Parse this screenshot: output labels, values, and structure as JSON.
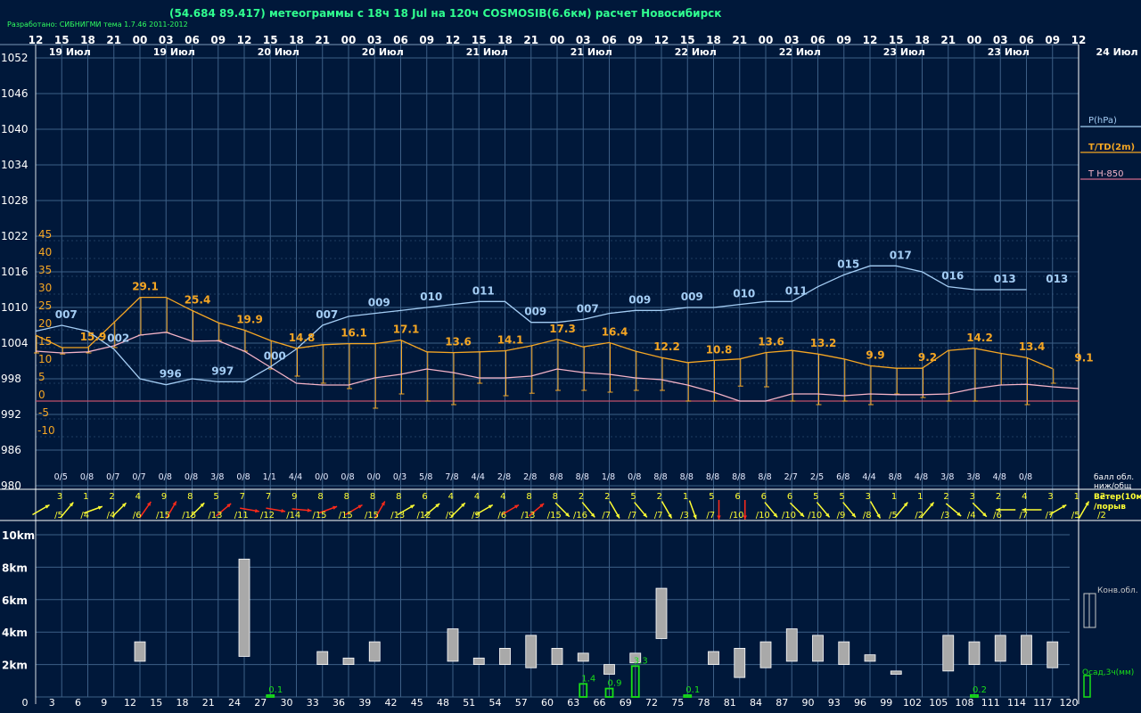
{
  "header": {
    "title": "(54.684 89.417) метеограммы с  18ч 18 Jul на 120ч COSMOSIB(6.6км) расчет Новосибирск",
    "credit": "Разработано: СИБНИГМИ тема 1.7.46 2011-2012"
  },
  "colors": {
    "background": "#00183a",
    "grid": "#3d5f86",
    "pressure": "#a4cdf4",
    "temperature": "#f5a623",
    "temp850": "#f5b4c8",
    "zero_line": "#c0506a",
    "cloud_bar": "#a9a9a9",
    "precip_bar": "#18e018",
    "wind_yellow": "#ffff33",
    "wind_red": "#ff2a1a",
    "text_white": "#ffffff",
    "credit": "#30ff60"
  },
  "chart_data": {
    "type": "line",
    "x_step_hours": 3,
    "top_hour_labels": [
      "12",
      "15",
      "18",
      "21",
      "00",
      "03",
      "06",
      "09",
      "12",
      "15",
      "18",
      "21",
      "00",
      "03",
      "06",
      "09",
      "12",
      "15",
      "18",
      "21",
      "00",
      "03",
      "06",
      "09",
      "12",
      "15",
      "18",
      "21",
      "00",
      "03",
      "06",
      "09",
      "12",
      "15",
      "18",
      "21",
      "00",
      "03",
      "06",
      "09",
      "12"
    ],
    "date_labels": [
      {
        "i": 1,
        "text": "19 Июл"
      },
      {
        "i": 5,
        "text": "19 Июл"
      },
      {
        "i": 9,
        "text": "20 Июл"
      },
      {
        "i": 13,
        "text": "20 Июл"
      },
      {
        "i": 17,
        "text": "21 Июл"
      },
      {
        "i": 21,
        "text": "21 Июл"
      },
      {
        "i": 25,
        "text": "22 Июл"
      },
      {
        "i": 29,
        "text": "22 Июл"
      },
      {
        "i": 33,
        "text": "23 Июл"
      },
      {
        "i": 37,
        "text": "23 Июл"
      },
      {
        "i": 41,
        "text": "24 Июл"
      }
    ],
    "pressure_axis": {
      "min": 980,
      "max": 1052,
      "step": 6,
      "label": "P(hPa)",
      "ticks": [
        "1052",
        "1046",
        "1040",
        "1034",
        "1028",
        "1022",
        "1016",
        "1010",
        "1004",
        "998",
        "992",
        "986",
        "980"
      ]
    },
    "temp_axis": {
      "min": -10,
      "max": 45,
      "step": 5,
      "label": "T/TD(2m)",
      "ticks": [
        "45",
        "40",
        "35",
        "30",
        "25",
        "20",
        "15",
        "10",
        "5",
        "0",
        "-5",
        "-10"
      ]
    },
    "temp850_label": "T H-850",
    "series": [
      {
        "name": "P(hPa)",
        "values": [
          1006,
          1007,
          1006,
          1003,
          998,
          997,
          998,
          997.5,
          997.5,
          1000,
          1003,
          1007,
          1008.5,
          1009,
          1009.5,
          1010,
          1010.5,
          1011,
          1011,
          1007.5,
          1007.5,
          1008,
          1009,
          1009.5,
          1009.5,
          1010,
          1010,
          1010.5,
          1011,
          1011,
          1013.5,
          1015.5,
          1017,
          1017,
          1016,
          1013.5,
          1013,
          1013,
          1013
        ]
      },
      {
        "name": "T/TD(2m)",
        "values": [
          18.5,
          15,
          15,
          22,
          29.1,
          29.1,
          25.4,
          22,
          19.9,
          17,
          14.8,
          15.8,
          16.1,
          16.1,
          17.1,
          13.8,
          13.6,
          13.8,
          14.1,
          15.5,
          17.3,
          15.2,
          16.4,
          14,
          12.2,
          10.8,
          11.4,
          11.8,
          13.6,
          14.2,
          13.2,
          11.8,
          9.9,
          9.2,
          9.2,
          14.2,
          14.8,
          13.4,
          12.2,
          9.1
        ]
      },
      {
        "name": "TD(2m)",
        "values": [
          13.5,
          13.2,
          13.5,
          15,
          18.5,
          19.2,
          16.8,
          17,
          14,
          9,
          7,
          5,
          3.5,
          -2,
          2,
          0,
          -1,
          5,
          1.5,
          2.2,
          3,
          3,
          2.5,
          3,
          3,
          0,
          0,
          4.2,
          4,
          0,
          -1,
          0,
          -1,
          2,
          1,
          0,
          0,
          4.5,
          -1,
          5
        ]
      },
      {
        "name": "T H-850",
        "values": [
          14,
          13.5,
          13.8,
          15.5,
          18.5,
          19.3,
          16.8,
          16.9,
          14,
          9.5,
          5,
          4.5,
          4.5,
          6.5,
          7.5,
          9,
          8,
          6.5,
          6.5,
          7,
          9,
          8,
          7.5,
          6.5,
          6,
          4.5,
          2.5,
          0,
          0,
          2,
          2,
          1.5,
          2,
          1.8,
          1.8,
          2,
          3.5,
          4.5,
          4.7,
          4,
          3.5
        ]
      }
    ],
    "pressure_labels": [
      {
        "i": 1,
        "text": "007"
      },
      {
        "i": 3,
        "text": "002"
      },
      {
        "i": 5,
        "text": "996"
      },
      {
        "i": 7,
        "text": "997"
      },
      {
        "i": 9,
        "text": "000"
      },
      {
        "i": 11,
        "text": "007"
      },
      {
        "i": 13,
        "text": "009"
      },
      {
        "i": 15,
        "text": "010"
      },
      {
        "i": 17,
        "text": "011"
      },
      {
        "i": 19,
        "text": "009"
      },
      {
        "i": 21,
        "text": "007"
      },
      {
        "i": 23,
        "text": "009"
      },
      {
        "i": 25,
        "text": "009"
      },
      {
        "i": 27,
        "text": "010"
      },
      {
        "i": 29,
        "text": "011"
      },
      {
        "i": 31,
        "text": "015"
      },
      {
        "i": 33,
        "text": "017"
      },
      {
        "i": 35,
        "text": "016"
      },
      {
        "i": 37,
        "text": "013"
      },
      {
        "i": 39,
        "text": "013"
      }
    ],
    "temp_labels": [
      {
        "i": 2,
        "text": "15.9"
      },
      {
        "i": 4,
        "text": "29.1"
      },
      {
        "i": 6,
        "text": "25.4"
      },
      {
        "i": 8,
        "text": "19.9"
      },
      {
        "i": 10,
        "text": "14.8"
      },
      {
        "i": 12,
        "text": "16.1"
      },
      {
        "i": 14,
        "text": "17.1"
      },
      {
        "i": 16,
        "text": "13.6"
      },
      {
        "i": 18,
        "text": "14.1"
      },
      {
        "i": 20,
        "text": "17.3"
      },
      {
        "i": 22,
        "text": "16.4"
      },
      {
        "i": 24,
        "text": "12.2"
      },
      {
        "i": 26,
        "text": "10.8"
      },
      {
        "i": 28,
        "text": "13.6"
      },
      {
        "i": 30,
        "text": "13.2"
      },
      {
        "i": 32,
        "text": "9.9"
      },
      {
        "i": 34,
        "text": "9.2"
      },
      {
        "i": 36,
        "text": "14.2"
      },
      {
        "i": 38,
        "text": "13.4"
      },
      {
        "i": 40,
        "text": "9.1"
      }
    ],
    "cloud_cover_label": "балл обл.\nниж/общ",
    "cloud_cover": [
      "0/5",
      "0/8",
      "0/7",
      "0/7",
      "0/8",
      "0/8",
      "3/8",
      "0/8",
      "1/1",
      "4/4",
      "0/0",
      "0/8",
      "0/0",
      "0/3",
      "5/8",
      "7/8",
      "4/4",
      "2/8",
      "2/8",
      "8/8",
      "8/8",
      "1/8",
      "0/8",
      "8/8",
      "8/8",
      "8/8",
      "8/8",
      "8/8",
      "2/7",
      "2/5",
      "6/8",
      "4/4",
      "8/8",
      "4/8",
      "3/8",
      "3/8",
      "4/8",
      "0/8"
    ],
    "wind_label": "Ветер(10м)\n/порыв",
    "wind": [
      {
        "s": "3",
        "g": "/5",
        "d": 60,
        "c": "y"
      },
      {
        "s": "1",
        "g": "/4",
        "d": 40,
        "c": "y"
      },
      {
        "s": "2",
        "g": "/4",
        "d": 70,
        "c": "y"
      },
      {
        "s": "4",
        "g": "/6",
        "d": 45,
        "c": "y"
      },
      {
        "s": "9",
        "g": "/15",
        "d": 35,
        "c": "r"
      },
      {
        "s": "8",
        "g": "/15",
        "d": 30,
        "c": "r"
      },
      {
        "s": "5",
        "g": "/13",
        "d": 45,
        "c": "y"
      },
      {
        "s": "7",
        "g": "/11",
        "d": 50,
        "c": "r"
      },
      {
        "s": "7",
        "g": "/12",
        "d": 100,
        "c": "r"
      },
      {
        "s": "9",
        "g": "/14",
        "d": 100,
        "c": "r"
      },
      {
        "s": "8",
        "g": "/15",
        "d": 95,
        "c": "r"
      },
      {
        "s": "8",
        "g": "/15",
        "d": 70,
        "c": "r"
      },
      {
        "s": "8",
        "g": "/15",
        "d": 60,
        "c": "r"
      },
      {
        "s": "8",
        "g": "/13",
        "d": 30,
        "c": "r"
      },
      {
        "s": "6",
        "g": "/12",
        "d": 60,
        "c": "y"
      },
      {
        "s": "4",
        "g": "/9",
        "d": 50,
        "c": "y"
      },
      {
        "s": "4",
        "g": "/9",
        "d": 45,
        "c": "y"
      },
      {
        "s": "4",
        "g": "/6",
        "d": 60,
        "c": "y"
      },
      {
        "s": "8",
        "g": "/13",
        "d": 60,
        "c": "r"
      },
      {
        "s": "8",
        "g": "/15",
        "d": 50,
        "c": "r"
      },
      {
        "s": "2",
        "g": "/16",
        "d": 135,
        "c": "y"
      },
      {
        "s": "2",
        "g": "/7",
        "d": 140,
        "c": "y"
      },
      {
        "s": "5",
        "g": "/7",
        "d": 150,
        "c": "y"
      },
      {
        "s": "2",
        "g": "/7",
        "d": 140,
        "c": "y"
      },
      {
        "s": "1",
        "g": "/3",
        "d": 150,
        "c": "y"
      },
      {
        "s": "5",
        "g": "/7",
        "d": 160,
        "c": "y"
      },
      {
        "s": "6",
        "g": "/10",
        "d": 180,
        "c": "r"
      },
      {
        "s": "6",
        "g": "/10",
        "d": 180,
        "c": "r"
      },
      {
        "s": "6",
        "g": "/10",
        "d": 140,
        "c": "y"
      },
      {
        "s": "5",
        "g": "/10",
        "d": 135,
        "c": "y"
      },
      {
        "s": "5",
        "g": "/9",
        "d": 140,
        "c": "y"
      },
      {
        "s": "3",
        "g": "/8",
        "d": 140,
        "c": "y"
      },
      {
        "s": "1",
        "g": "/5",
        "d": 150,
        "c": "y"
      },
      {
        "s": "1",
        "g": "/2",
        "d": 40,
        "c": "y"
      },
      {
        "s": "2",
        "g": "/3",
        "d": 40,
        "c": "y"
      },
      {
        "s": "3",
        "g": "/4",
        "d": 130,
        "c": "y"
      },
      {
        "s": "2",
        "g": "/6",
        "d": 135,
        "c": "y"
      },
      {
        "s": "4",
        "g": "/7",
        "d": 270,
        "c": "y"
      },
      {
        "s": "3",
        "g": "/7",
        "d": 270,
        "c": "y"
      },
      {
        "s": "1",
        "g": "/5",
        "d": 60,
        "c": "y"
      },
      {
        "s": "2",
        "g": "/2",
        "d": 30,
        "c": "y"
      }
    ],
    "height_axis": {
      "min": 0,
      "max": 10,
      "unit": "km",
      "ticks": [
        "10km",
        "8km",
        "6km",
        "4km",
        "2km"
      ]
    },
    "bottom_hours": [
      "0",
      "3",
      "6",
      "9",
      "12",
      "15",
      "18",
      "21",
      "24",
      "27",
      "30",
      "33",
      "36",
      "39",
      "42",
      "45",
      "48",
      "51",
      "54",
      "57",
      "60",
      "63",
      "66",
      "69",
      "72",
      "75",
      "78",
      "81",
      "84",
      "87",
      "90",
      "93",
      "96",
      "99",
      "102",
      "105",
      "108",
      "111",
      "114",
      "117",
      "120"
    ],
    "convective_cloud_label": "Конв.обл.",
    "convective_clouds": [
      {
        "h": 12,
        "base": 2.2,
        "top": 3.4
      },
      {
        "h": 24,
        "base": 2.5,
        "top": 8.5
      },
      {
        "h": 33,
        "base": 2.0,
        "top": 2.8
      },
      {
        "h": 36,
        "base": 2.0,
        "top": 2.4
      },
      {
        "h": 39,
        "base": 2.2,
        "top": 3.4
      },
      {
        "h": 48,
        "base": 2.2,
        "top": 4.2
      },
      {
        "h": 51,
        "base": 2.0,
        "top": 2.4
      },
      {
        "h": 54,
        "base": 2.0,
        "top": 3.0
      },
      {
        "h": 57,
        "base": 1.8,
        "top": 3.8
      },
      {
        "h": 60,
        "base": 2.0,
        "top": 3.0
      },
      {
        "h": 63,
        "base": 2.2,
        "top": 2.7
      },
      {
        "h": 66,
        "base": 1.4,
        "top": 2.0
      },
      {
        "h": 69,
        "base": 2.1,
        "top": 2.7
      },
      {
        "h": 72,
        "base": 3.6,
        "top": 6.7
      },
      {
        "h": 78,
        "base": 2.0,
        "top": 2.8
      },
      {
        "h": 81,
        "base": 1.2,
        "top": 3.0
      },
      {
        "h": 84,
        "base": 1.8,
        "top": 3.4
      },
      {
        "h": 87,
        "base": 2.2,
        "top": 4.2
      },
      {
        "h": 90,
        "base": 2.2,
        "top": 3.8
      },
      {
        "h": 93,
        "base": 2.0,
        "top": 3.4
      },
      {
        "h": 96,
        "base": 2.2,
        "top": 2.6
      },
      {
        "h": 99,
        "base": 1.4,
        "top": 1.6
      },
      {
        "h": 105,
        "base": 1.6,
        "top": 3.8
      },
      {
        "h": 108,
        "base": 2.0,
        "top": 3.4
      },
      {
        "h": 111,
        "base": 2.2,
        "top": 3.8
      },
      {
        "h": 114,
        "base": 2.0,
        "top": 3.8
      },
      {
        "h": 117,
        "base": 1.8,
        "top": 3.4
      }
    ],
    "precip_label": "Осад,3ч(мм)",
    "precipitation": [
      {
        "h": 27,
        "v": 0.1,
        "text": "0.1"
      },
      {
        "h": 63,
        "v": 1.4,
        "text": "1.4"
      },
      {
        "h": 66,
        "v": 0.9,
        "text": "0.9"
      },
      {
        "h": 69,
        "v": 3.3,
        "text": "3.3"
      },
      {
        "h": 75,
        "v": 0.1,
        "text": "0.1"
      },
      {
        "h": 108,
        "v": 0.2,
        "text": "0.2"
      }
    ]
  }
}
